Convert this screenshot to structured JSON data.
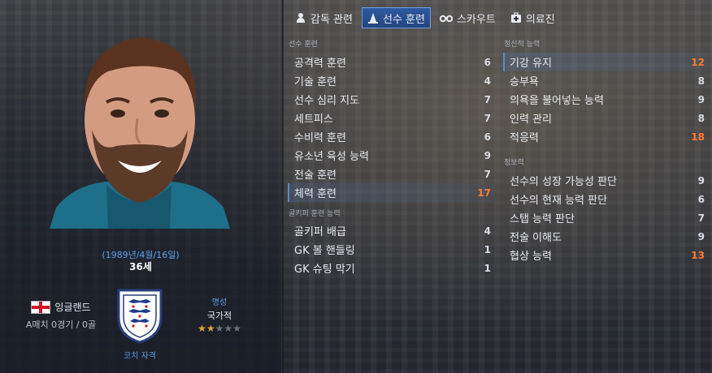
{
  "tabs": [
    {
      "label": "감독 관련",
      "icon": "person-icon",
      "active": false
    },
    {
      "label": "선수 훈련",
      "icon": "training-cone-icon",
      "active": true
    },
    {
      "label": "스카우트",
      "icon": "binoculars-icon",
      "active": false
    },
    {
      "label": "의료진",
      "icon": "medical-kit-icon",
      "active": false
    }
  ],
  "profile": {
    "dob": "(1989년/4월/16일)",
    "age": "36세",
    "nation": "잉글랜드",
    "caps": "A매치 0경기 / 0골",
    "badge_caption": "코치 자격",
    "reputation_label": "명성",
    "reputation_value": "국가적",
    "reputation_stars": 2,
    "reputation_stars_max": 5
  },
  "training": {
    "title": "선수 훈련",
    "items": [
      {
        "name": "공격력 훈련",
        "value": "6"
      },
      {
        "name": "기술 훈련",
        "value": "4"
      },
      {
        "name": "선수 심리 지도",
        "value": "7"
      },
      {
        "name": "세트피스",
        "value": "7"
      },
      {
        "name": "수비력 훈련",
        "value": "6"
      },
      {
        "name": "유소년 육성 능력",
        "value": "9"
      },
      {
        "name": "전술 훈련",
        "value": "7"
      },
      {
        "name": "체력 훈련",
        "value": "17"
      }
    ]
  },
  "goalkeeping": {
    "title": "골키퍼 훈련 능력",
    "items": [
      {
        "name": "골키퍼 배급",
        "value": "4"
      },
      {
        "name": "GK 볼 핸들링",
        "value": "1"
      },
      {
        "name": "GK 슈팅 막기",
        "value": "1"
      }
    ]
  },
  "mental": {
    "title": "정신적 능력",
    "items": [
      {
        "name": "기강 유지",
        "value": "12"
      },
      {
        "name": "승부욕",
        "value": "8"
      },
      {
        "name": "의욕을 불어넣는 능력",
        "value": "9"
      },
      {
        "name": "인력 관리",
        "value": "8"
      },
      {
        "name": "적응력",
        "value": "18"
      }
    ]
  },
  "knowledge": {
    "title": "정보력",
    "items": [
      {
        "name": "선수의 성장 가능성 판단",
        "value": "9"
      },
      {
        "name": "선수의 현재 능력 판단",
        "value": "6"
      },
      {
        "name": "스탭 능력 판단",
        "value": "7"
      },
      {
        "name": "전술 이해도",
        "value": "9"
      },
      {
        "name": "협상 능력",
        "value": "13"
      }
    ]
  },
  "colors": {
    "accent": "#2f5aa0",
    "highlight_value": "#ff7a2f",
    "link": "#5aa0e6"
  }
}
